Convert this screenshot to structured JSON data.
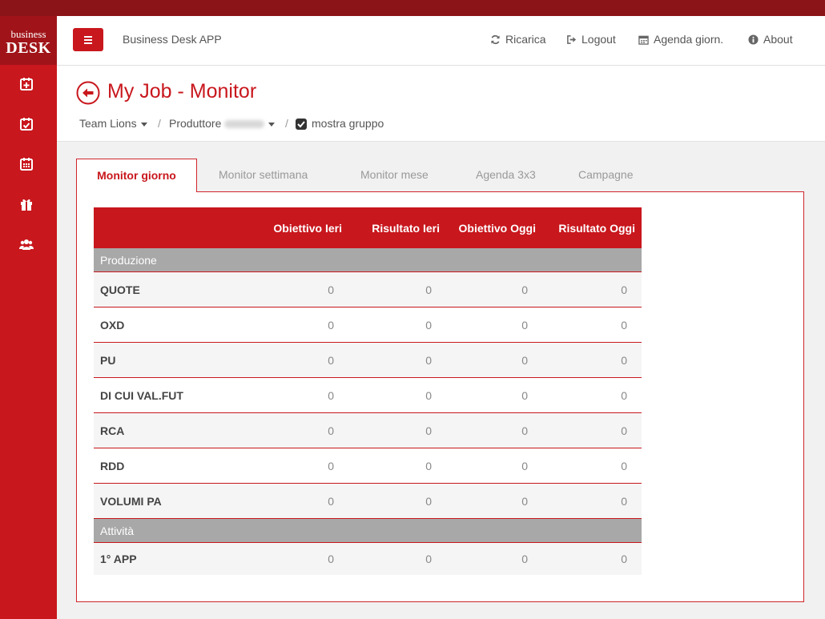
{
  "brand": {
    "line1": "business",
    "line2": "DESK"
  },
  "sidebar": {
    "icons": [
      "calendar-plus-icon",
      "calendar-check-icon",
      "calendar-icon",
      "gift-icon",
      "users-icon"
    ]
  },
  "header": {
    "app_title": "Business Desk APP",
    "nav": [
      {
        "icon": "refresh-icon",
        "label": "Ricarica"
      },
      {
        "icon": "logout-icon",
        "label": "Logout"
      },
      {
        "icon": "calendar-icon",
        "label": "Agenda giorn."
      },
      {
        "icon": "info-icon",
        "label": "About"
      }
    ]
  },
  "page": {
    "title": "My Job - Monitor",
    "breadcrumb": {
      "team": "Team Lions",
      "producer": "Produttore",
      "sep": "/",
      "group_label": "mostra gruppo"
    }
  },
  "tabs": [
    "Monitor giorno",
    "Monitor settimana",
    "Monitor mese",
    "Agenda 3x3",
    "Campagne"
  ],
  "table": {
    "headers": [
      "",
      "Obiettivo Ieri",
      "Risultato Ieri",
      "Obiettivo Oggi",
      "Risultato Oggi"
    ],
    "sections": [
      {
        "name": "Produzione",
        "rows": [
          {
            "label": "QUOTE",
            "values": [
              "0",
              "0",
              "0",
              "0"
            ]
          },
          {
            "label": "OXD",
            "values": [
              "0",
              "0",
              "0",
              "0"
            ]
          },
          {
            "label": "PU",
            "values": [
              "0",
              "0",
              "0",
              "0"
            ]
          },
          {
            "label": "DI CUI VAL.FUT",
            "values": [
              "0",
              "0",
              "0",
              "0"
            ]
          },
          {
            "label": "RCA",
            "values": [
              "0",
              "0",
              "0",
              "0"
            ]
          },
          {
            "label": "RDD",
            "values": [
              "0",
              "0",
              "0",
              "0"
            ]
          },
          {
            "label": "VOLUMI PA",
            "values": [
              "0",
              "0",
              "0",
              "0"
            ]
          }
        ]
      },
      {
        "name": "Attività",
        "rows": [
          {
            "label": "1° APP",
            "values": [
              "0",
              "0",
              "0",
              "0"
            ]
          }
        ]
      }
    ]
  },
  "colors": {
    "brand_red": "#c8171d",
    "dark_red": "#8b1419",
    "section_gray": "#a8a8a8"
  }
}
